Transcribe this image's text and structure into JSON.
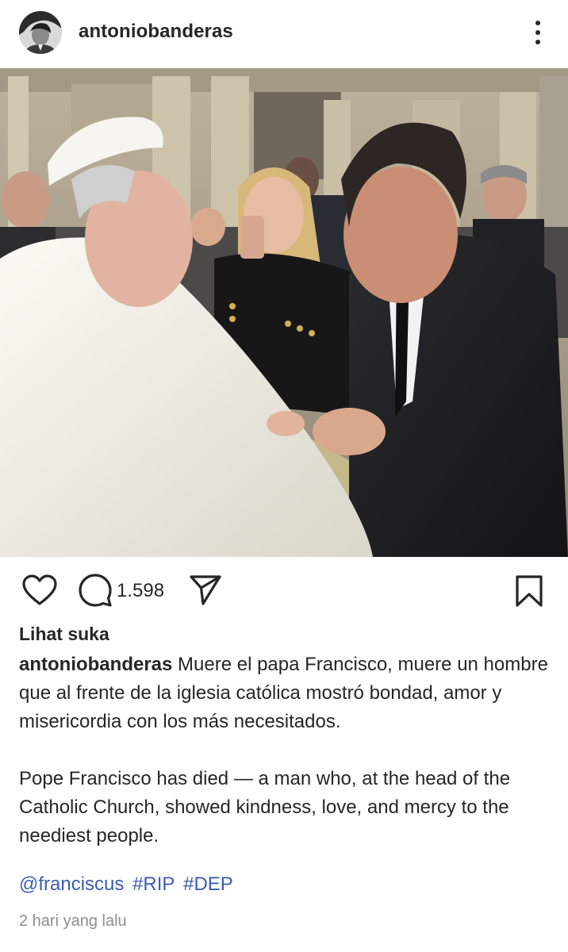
{
  "post": {
    "username": "antoniobanderas",
    "comment_count": "1.598",
    "likes_link": "Lihat suka",
    "caption_username": "antoniobanderas",
    "caption_spanish": "Muere el papa Francisco, muere un hombre que al frente de la iglesia católica mostró bondad, amor y misericordia con los más necesitados.",
    "caption_english": "Pope Francisco has died — a man who, at the head of the Catholic Church, showed kindness, love, and mercy to the neediest people.",
    "tags": {
      "mention": "@franciscus",
      "hashtag_1": "#RIP",
      "hashtag_2": "#DEP"
    },
    "timestamp": "2 hari yang lalu"
  },
  "icons": {
    "more": "more-vertical-icon",
    "like": "heart-icon",
    "comment": "comment-icon",
    "share": "send-icon",
    "save": "bookmark-icon"
  },
  "colors": {
    "text": "#262626",
    "link": "#3b5cb0",
    "muted": "#8e8e8e"
  }
}
